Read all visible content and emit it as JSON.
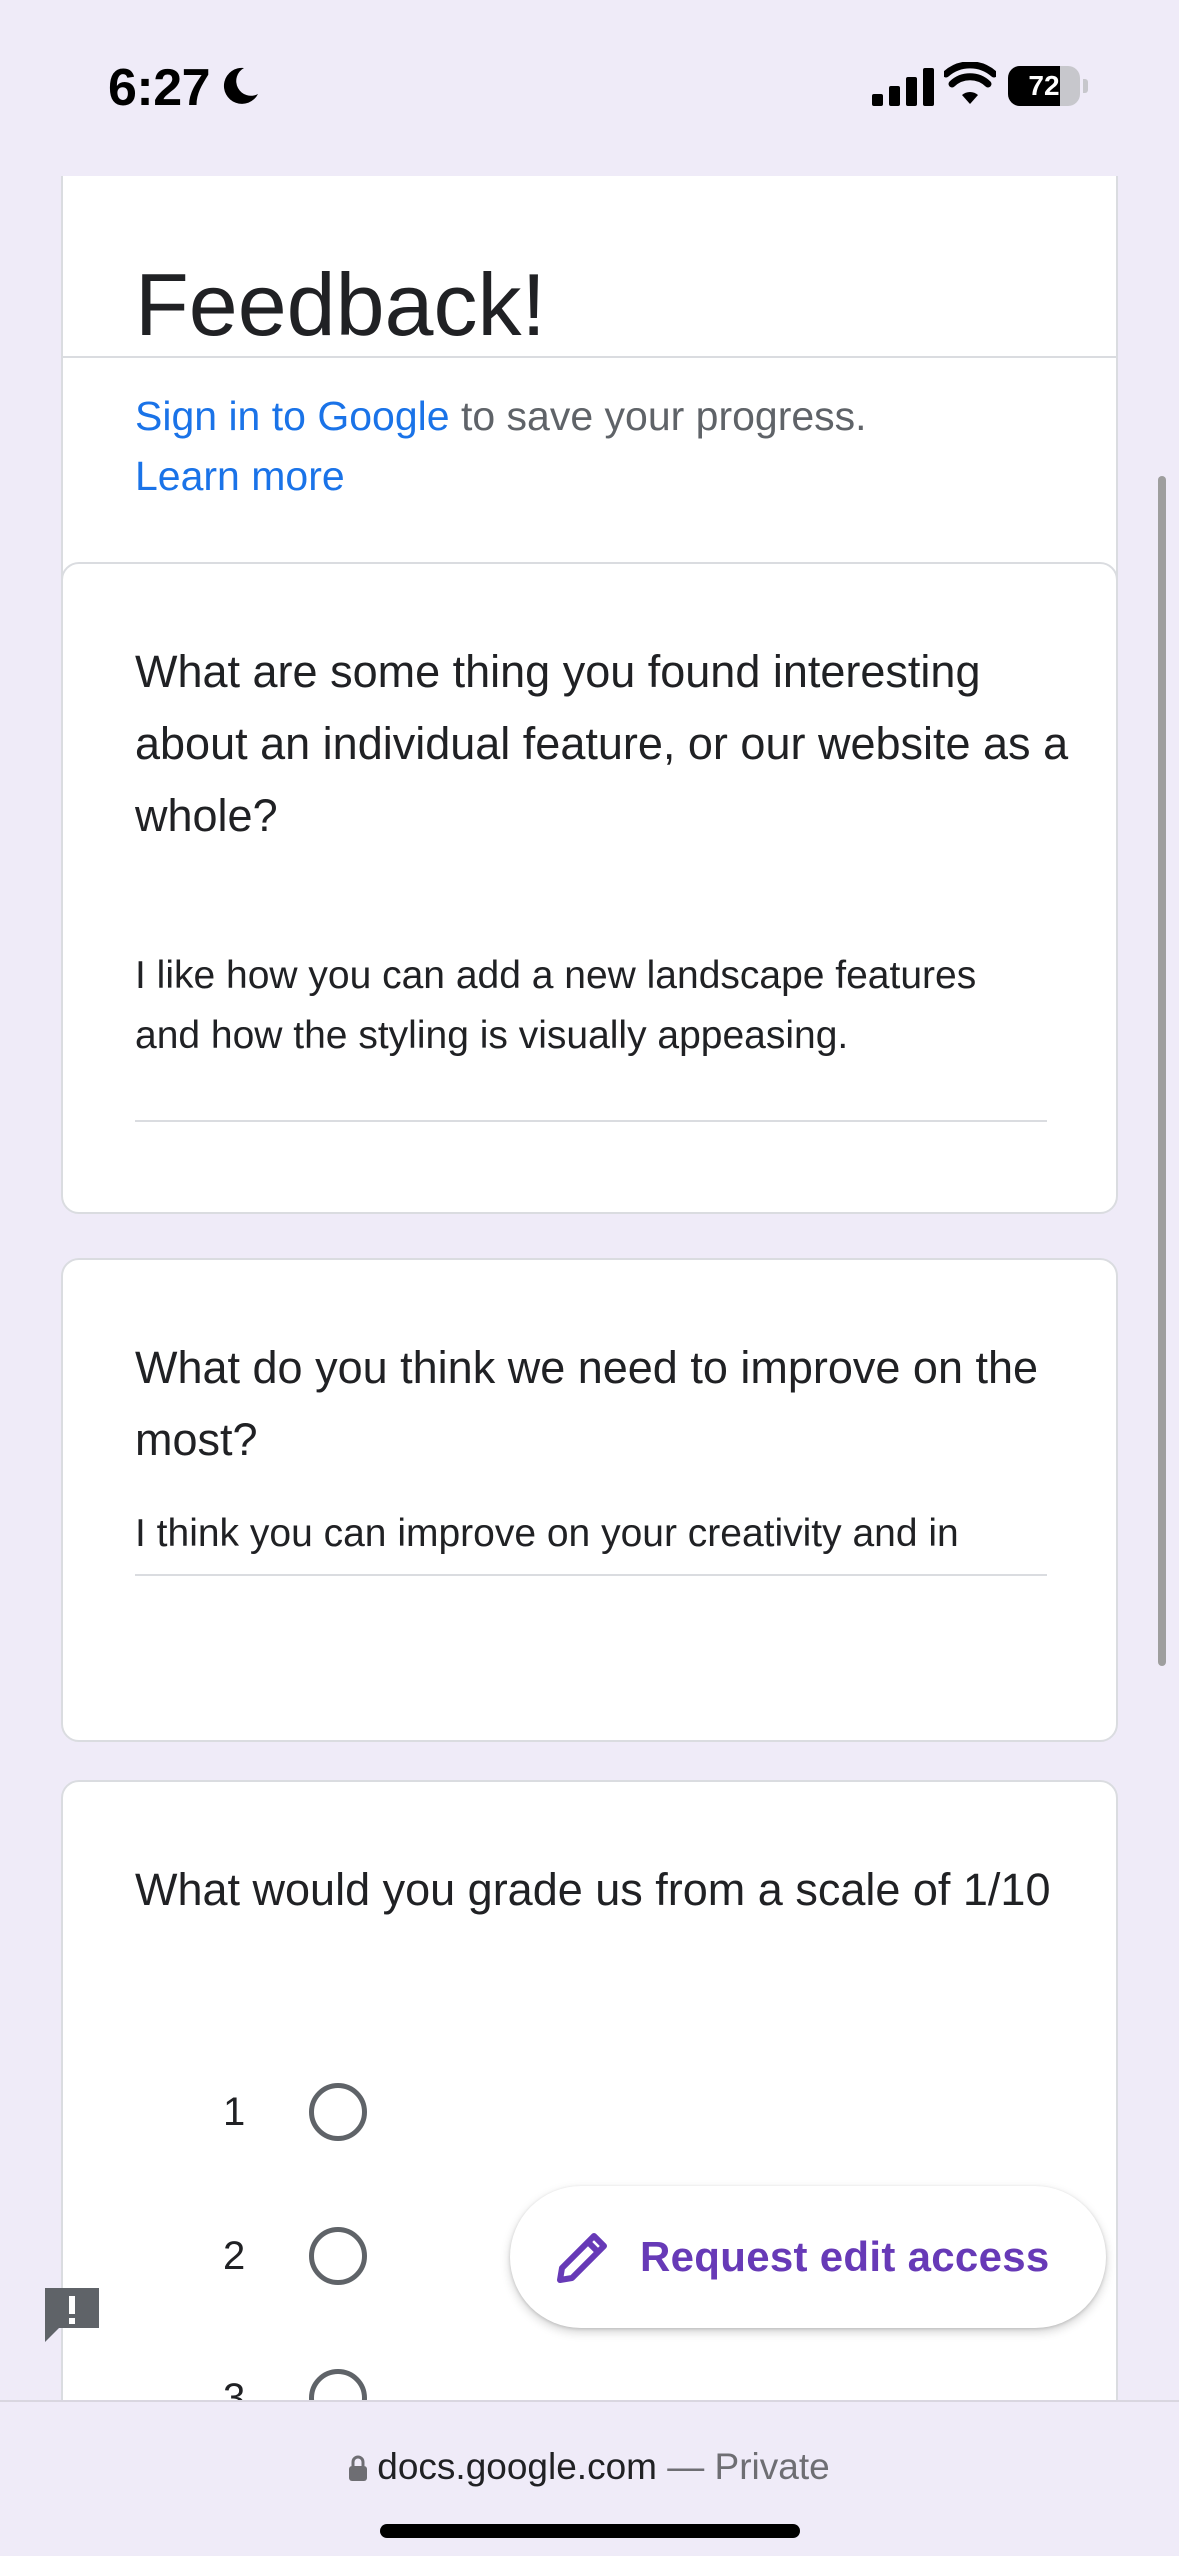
{
  "status_bar": {
    "time": "6:27",
    "battery_percent": "72",
    "battery_level": 0.72,
    "icons": [
      "moon-icon",
      "cellular-signal-icon",
      "wifi-icon",
      "battery-icon"
    ]
  },
  "form": {
    "title": "Feedback!",
    "signin": {
      "link_text": "Sign in to Google",
      "rest_text": " to save your progress.",
      "learn_more": "Learn more"
    }
  },
  "questions": [
    {
      "text": "What are some thing you found interesting about an individual feature, or our website as a whole?",
      "answer": "I like how  you can add a new landscape features and how the styling is visually appeasing."
    },
    {
      "text": "What do you think we need to improve on the most?",
      "answer": "I think you can improve on your creativity and in"
    },
    {
      "text": "What would you grade us from a scale of 1/10",
      "options": [
        "1",
        "2",
        "3"
      ]
    }
  ],
  "fab": {
    "label": "Request edit access",
    "icon": "pencil-icon"
  },
  "report_button": {
    "icon": "report-problem-icon"
  },
  "browser": {
    "domain": "docs.google.com",
    "private_label": " — Private",
    "icon": "lock-icon"
  },
  "colors": {
    "background": "#EFEBF8",
    "link": "#1A73E8",
    "accent": "#673AB7",
    "text": "#202124",
    "muted": "#5F6368"
  }
}
